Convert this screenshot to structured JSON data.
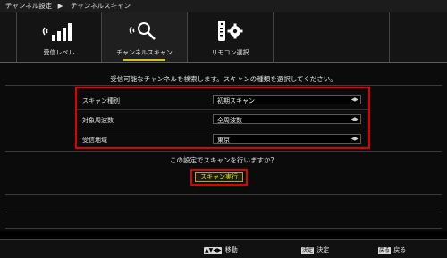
{
  "breadcrumb": {
    "parent": "チャンネル設定",
    "separator": "▶",
    "current": "チャンネルスキャン"
  },
  "tabs": [
    {
      "label": "受信レベル",
      "icon": "signal-level-icon"
    },
    {
      "label": "チャンネルスキャン",
      "icon": "channel-scan-icon",
      "active": true
    },
    {
      "label": "リモコン選択",
      "icon": "remote-settings-icon"
    }
  ],
  "instruction": "受信可能なチャンネルを検索します。スキャンの種類を選択してください。",
  "settings": [
    {
      "label": "スキャン種別",
      "value": "初期スキャン"
    },
    {
      "label": "対象周波数",
      "value": "全周波数"
    },
    {
      "label": "受信地域",
      "value": "東京"
    }
  ],
  "select_arrows": "◀▶",
  "question": "この設定でスキャンを行いますか？",
  "exec_button": "スキャン実行",
  "footer": {
    "move_keys": "▲▼◀▶",
    "move_label": "移動",
    "confirm_key": "決定",
    "confirm_label": "決定",
    "back_key": "戻る",
    "back_label": "戻る"
  },
  "colors": {
    "highlight_red": "#e00000",
    "accent_yellow": "#e8e800"
  }
}
